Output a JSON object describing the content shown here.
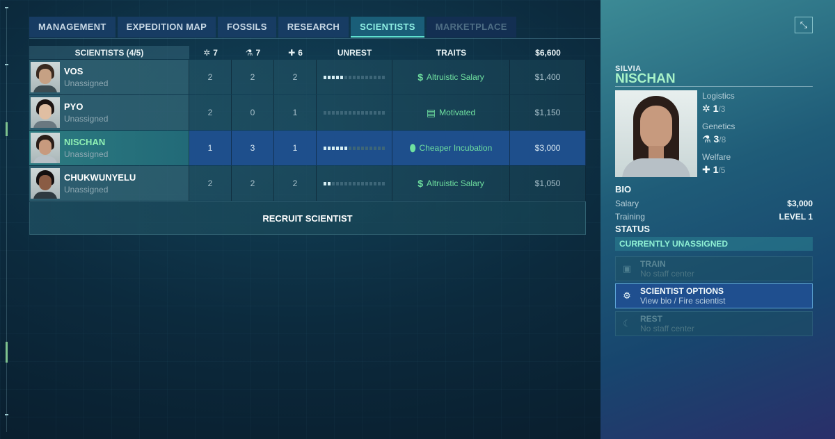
{
  "tabs": [
    {
      "label": "MANAGEMENT",
      "state": "normal"
    },
    {
      "label": "EXPEDITION MAP",
      "state": "normal"
    },
    {
      "label": "FOSSILS",
      "state": "normal"
    },
    {
      "label": "RESEARCH",
      "state": "normal"
    },
    {
      "label": "SCIENTISTS",
      "state": "active"
    },
    {
      "label": "MARKETPLACE",
      "state": "disabled"
    }
  ],
  "table": {
    "header": {
      "scientists": "SCIENTISTS (4/5)",
      "logistics_total": "7",
      "genetics_total": "7",
      "welfare_total": "6",
      "unrest": "UNREST",
      "traits": "TRAITS",
      "cost_total": "$6,600"
    },
    "rows": [
      {
        "name": "VOS",
        "status": "Unassigned",
        "logistics": "2",
        "genetics": "2",
        "welfare": "2",
        "unrest_level": 0.3,
        "trait_icon": "dollar-icon",
        "trait": "Altruistic Salary",
        "salary": "$1,400",
        "selected": false
      },
      {
        "name": "PYO",
        "status": "Unassigned",
        "logistics": "2",
        "genetics": "0",
        "welfare": "1",
        "unrest_level": 0.0,
        "trait_icon": "clipboard-icon",
        "trait": "Motivated",
        "salary": "$1,150",
        "selected": false
      },
      {
        "name": "NISCHAN",
        "status": "Unassigned",
        "logistics": "1",
        "genetics": "3",
        "welfare": "1",
        "unrest_level": 0.4,
        "trait_icon": "egg-icon",
        "trait": "Cheaper Incubation",
        "salary": "$3,000",
        "selected": true
      },
      {
        "name": "CHUKWUNYELU",
        "status": "Unassigned",
        "logistics": "2",
        "genetics": "2",
        "welfare": "2",
        "unrest_level": 0.1,
        "trait_icon": "dollar-icon",
        "trait": "Altruistic Salary",
        "salary": "$1,050",
        "selected": false
      }
    ],
    "recruit_label": "RECRUIT SCIENTIST"
  },
  "detail": {
    "first_name": "SILVIA",
    "last_name": "NISCHAN",
    "stats": [
      {
        "label": "Logistics",
        "icon": "gear-icon",
        "value": "1",
        "max": "/3"
      },
      {
        "label": "Genetics",
        "icon": "flask-icon",
        "value": "3",
        "max": "/8"
      },
      {
        "label": "Welfare",
        "icon": "cross-icon",
        "value": "1",
        "max": "/5"
      }
    ],
    "bio_title": "BIO",
    "salary_label": "Salary",
    "salary_value": "$3,000",
    "training_label": "Training",
    "training_value": "LEVEL 1",
    "status_title": "STATUS",
    "status_value": "CURRENTLY UNASSIGNED",
    "options": [
      {
        "title": "TRAIN",
        "sub": "No staff center",
        "enabled": false
      },
      {
        "title": "SCIENTIST OPTIONS",
        "sub": "View bio / Fire scientist",
        "enabled": true
      },
      {
        "title": "REST",
        "sub": "No staff center",
        "enabled": false
      }
    ]
  },
  "colors": {
    "accent_teal": "#5fe0d0",
    "trait_green": "#6fe0a0",
    "selected_row": "#1e4f8c",
    "name_green": "#a8f3c8"
  }
}
